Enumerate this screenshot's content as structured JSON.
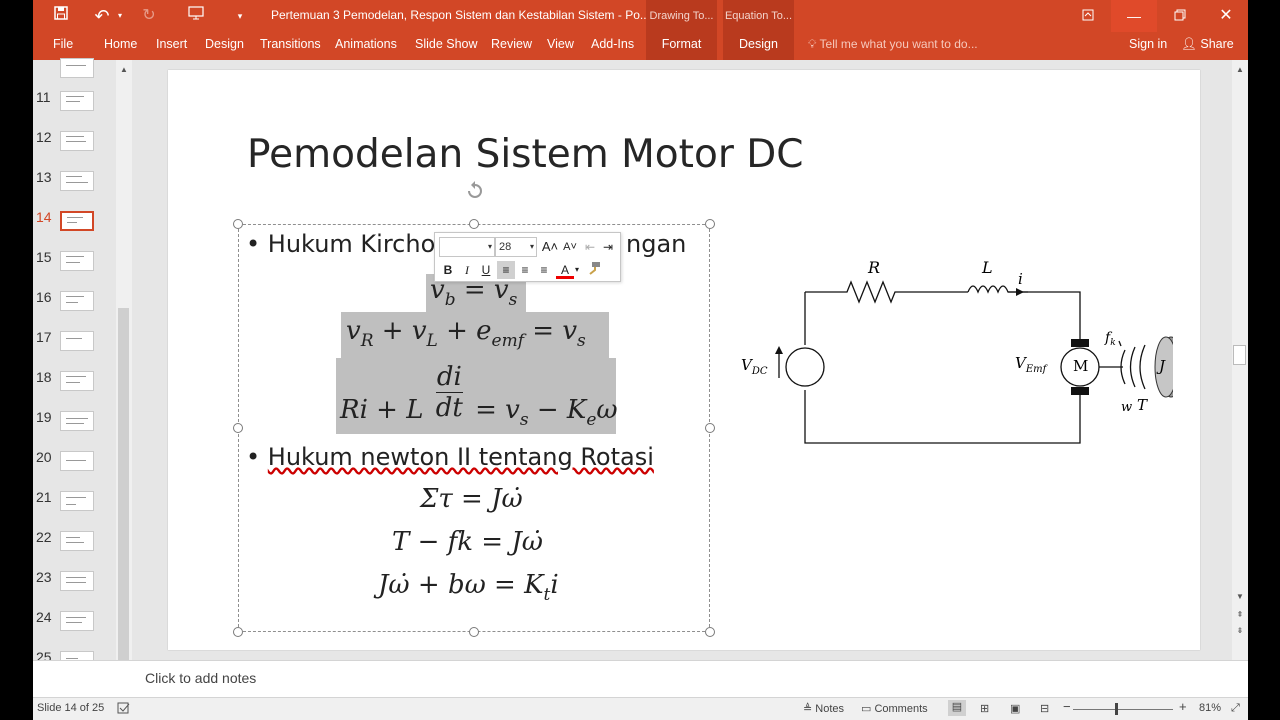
{
  "window": {
    "title": "Pertemuan 3 Pemodelan, Respon Sistem dan Kestabilan Sistem - Po...",
    "context_tabs": [
      "Drawing To...",
      "Equation To..."
    ]
  },
  "ribbon": {
    "tabs": [
      "File",
      "Home",
      "Insert",
      "Design",
      "Transitions",
      "Animations",
      "Slide Show",
      "Review",
      "View",
      "Add-Ins"
    ],
    "context_tabs": [
      "Format",
      "Design"
    ],
    "tell_me_placeholder": "Tell me what you want to do...",
    "sign_in": "Sign in",
    "share": "Share"
  },
  "thumbnails": {
    "numbers": [
      "11",
      "12",
      "13",
      "14",
      "15",
      "16",
      "17",
      "18",
      "19",
      "20",
      "21",
      "22",
      "23",
      "24",
      "25"
    ],
    "active": "14"
  },
  "slide": {
    "title": "Pemodelan Sistem Motor DC",
    "bullet1_visible_left": "Hukum Kircho",
    "bullet1_visible_right": "ngan",
    "bullet2": "Hukum newton II tentang Rotasi",
    "circuit_labels": {
      "r": "R",
      "l": "L",
      "i": "i",
      "vdc": "V",
      "vdc_sub": "DC",
      "vemf": "V",
      "vemf_sub": "Emf",
      "motor": "M",
      "fk": "f",
      "fk_sub": "k",
      "j": "J",
      "w": "w",
      "t": "T"
    }
  },
  "mini_toolbar": {
    "font_size": "28",
    "grow": "A",
    "shrink": "A",
    "bold": "B",
    "italic": "I",
    "underline": "U",
    "font_color": "A"
  },
  "notes": {
    "placeholder": "Click to add notes"
  },
  "status": {
    "slide_counter": "Slide 14 of 25",
    "notes": "Notes",
    "comments": "Comments",
    "zoom": "81%"
  }
}
